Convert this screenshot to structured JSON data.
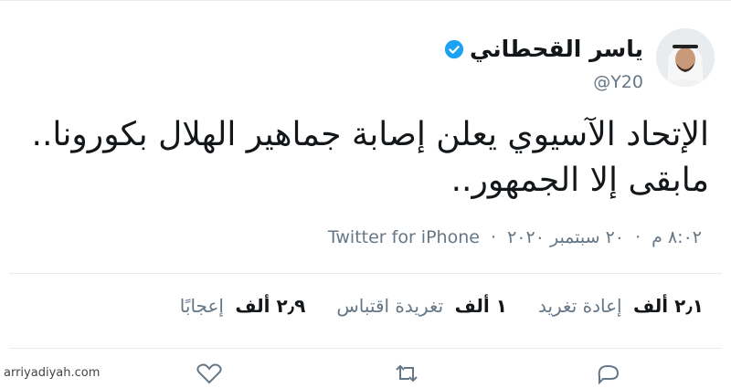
{
  "tweet": {
    "author": {
      "display_name": "ياسر القحطاني",
      "handle": "@Y20",
      "verified": true
    },
    "text_line1": "الإتحاد الآسيوي يعلن إصابة جماهير الهلال بكورونا..",
    "text_line2": "مابقى إلا الجمهور..",
    "time": "٨:٠٢ م",
    "separator": "·",
    "date": "٢٠ سبتمبر ٢٠٢٠",
    "source": "Twitter for iPhone",
    "stats": {
      "retweets": {
        "value": "٢٫١ ألف",
        "label": "إعادة تغريد"
      },
      "quotes": {
        "value": "١ ألف",
        "label": "تغريدة اقتباس"
      },
      "likes": {
        "value": "٢٫٩ ألف",
        "label": "إعجابًا"
      }
    }
  },
  "watermark": "arriyadiyah.com",
  "colors": {
    "text": "#14171a",
    "muted": "#657786",
    "divider": "#e6ecf0",
    "verified": "#1da1f2"
  },
  "icons": [
    "verified-badge-icon",
    "reply-icon",
    "retweet-icon",
    "like-icon",
    "share-icon"
  ]
}
